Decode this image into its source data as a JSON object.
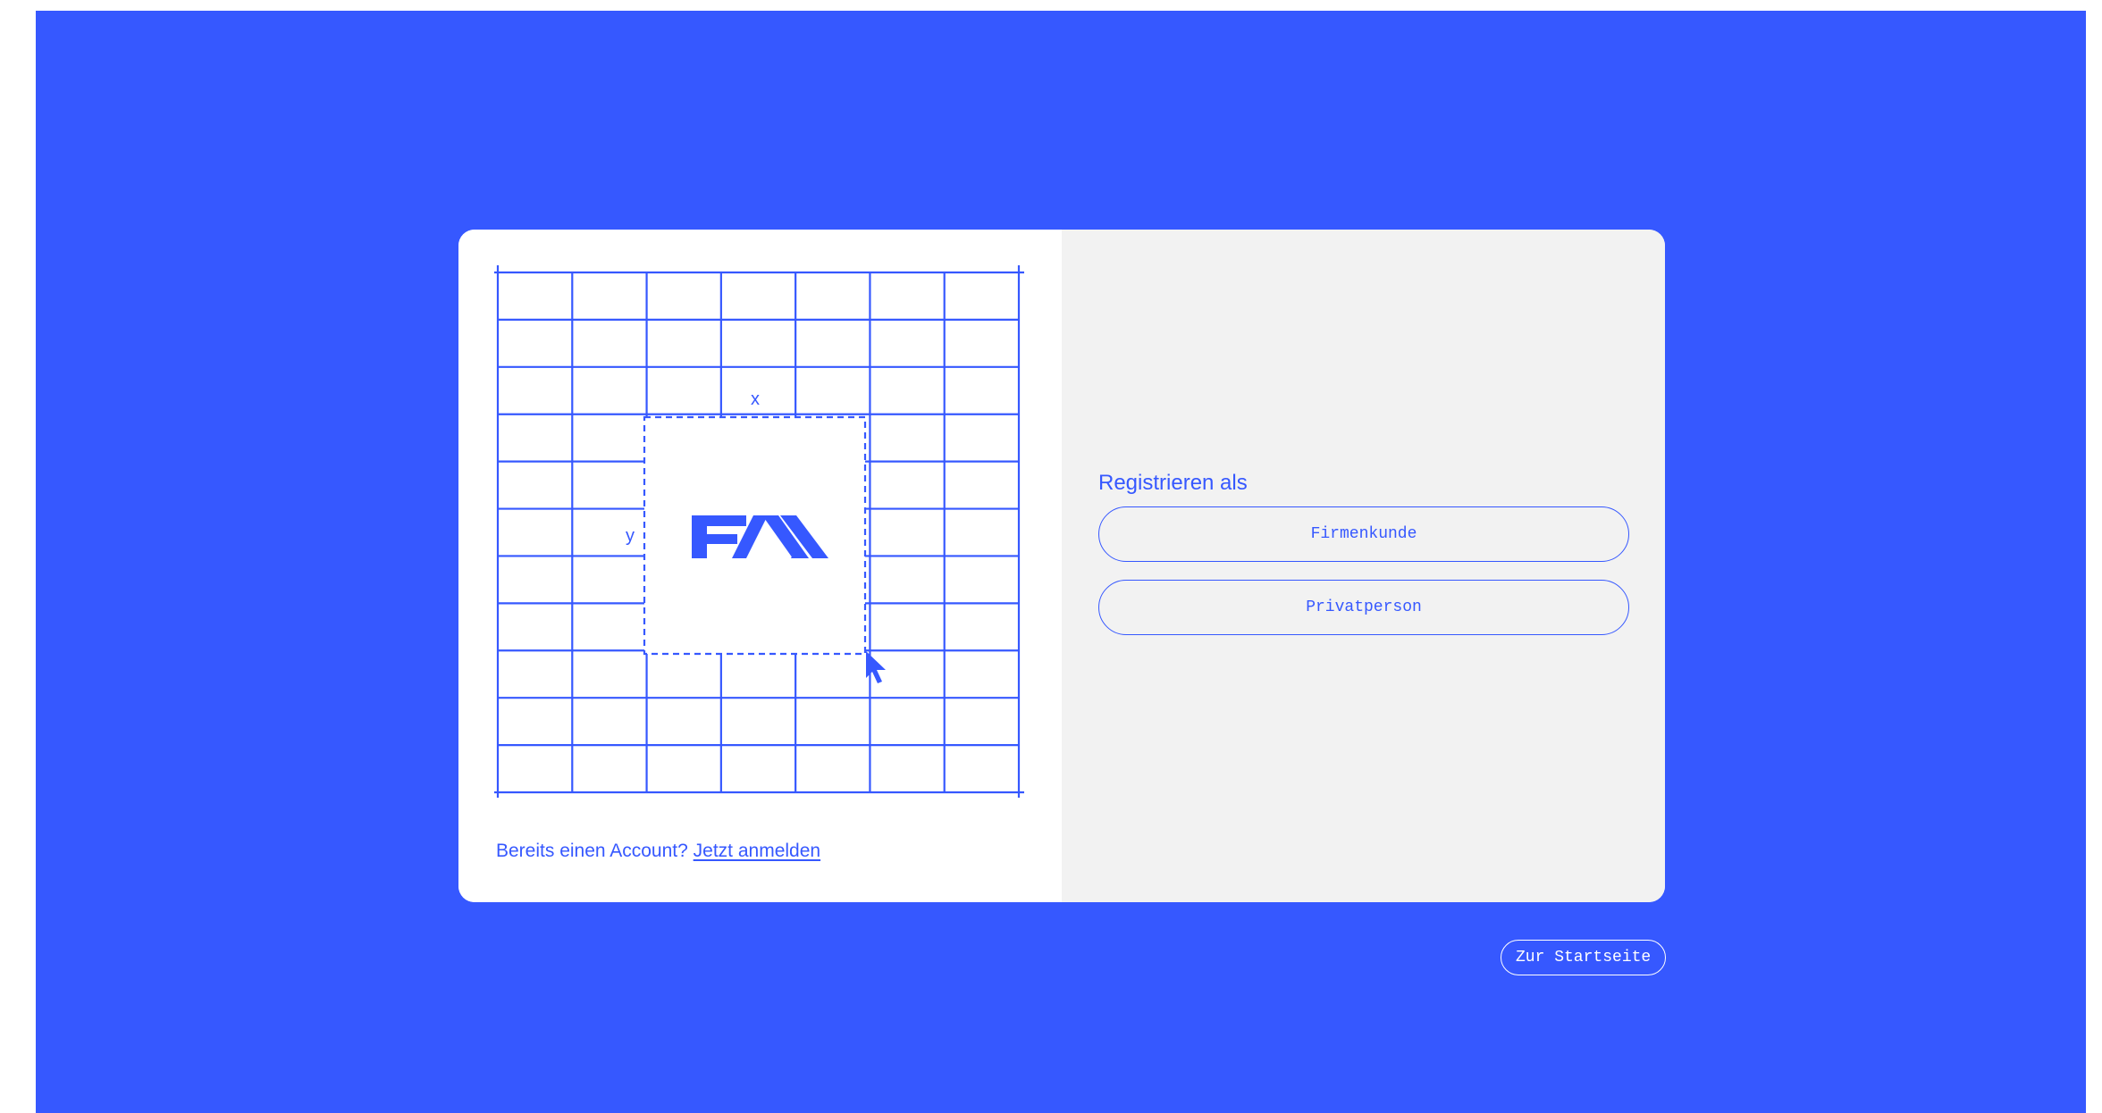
{
  "colors": {
    "brand_blue": "#3658ff",
    "card_left_bg": "#ffffff",
    "card_right_bg": "#f2f2f2"
  },
  "illustration": {
    "axis_x_label": "x",
    "axis_y_label": "y",
    "logo_text": "FXX",
    "icons": [
      "grid-icon",
      "fxx-logo",
      "cursor-arrow-icon"
    ]
  },
  "login": {
    "prompt": "Bereits einen Account?",
    "link_label": "Jetzt anmelden"
  },
  "register": {
    "title": "Registrieren als",
    "options": [
      {
        "label": "Firmenkunde"
      },
      {
        "label": "Privatperson"
      }
    ]
  },
  "footer": {
    "home_label": "Zur Startseite"
  }
}
